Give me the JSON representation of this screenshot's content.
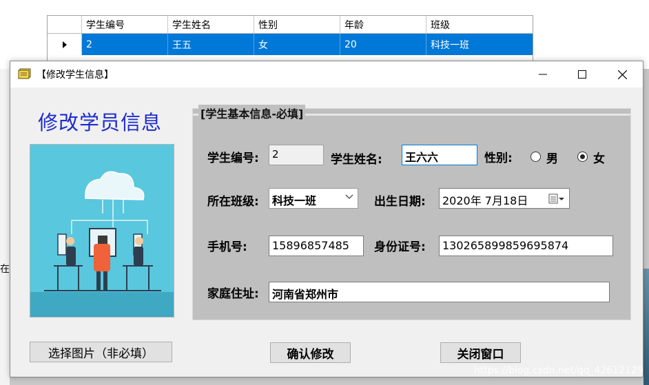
{
  "background": {
    "sliver_text": "在纟"
  },
  "grid": {
    "columns": [
      "学生编号",
      "学生姓名",
      "性别",
      "年龄",
      "班级"
    ],
    "row": [
      "2",
      "王五",
      "女",
      "20",
      "科技一班"
    ]
  },
  "dialog": {
    "title": "【修改学生信息】",
    "heading": "修改学员信息",
    "group_title": "[学生基本信息-必填]",
    "labels": {
      "student_id": "学生编号:",
      "student_name": "学生姓名:",
      "gender": "性别:",
      "class": "所在班级:",
      "birth_date": "出生日期:",
      "phone": "手机号:",
      "id_card": "身份证号:",
      "address": "家庭住址:"
    },
    "values": {
      "student_id": "2",
      "student_name": "王六六",
      "class": "科技一班",
      "birth_date": "2020年  7月18日",
      "phone": "15896857485",
      "id_card": "130265899859695874",
      "address": "河南省郑州市"
    },
    "gender_options": [
      {
        "label": "男",
        "checked": false
      },
      {
        "label": "女",
        "checked": true
      }
    ],
    "buttons": {
      "choose_photo": "选择图片（非必填）",
      "confirm": "确认修改",
      "close": "关闭窗口"
    }
  },
  "watermark": "https://blog.csdn.net/qq_42612129",
  "colors": {
    "heading": "#1d2bd0",
    "selected_row": "#0078d7",
    "group_bg": "#bfbfbf",
    "photo_bg": "#59c7dd"
  }
}
